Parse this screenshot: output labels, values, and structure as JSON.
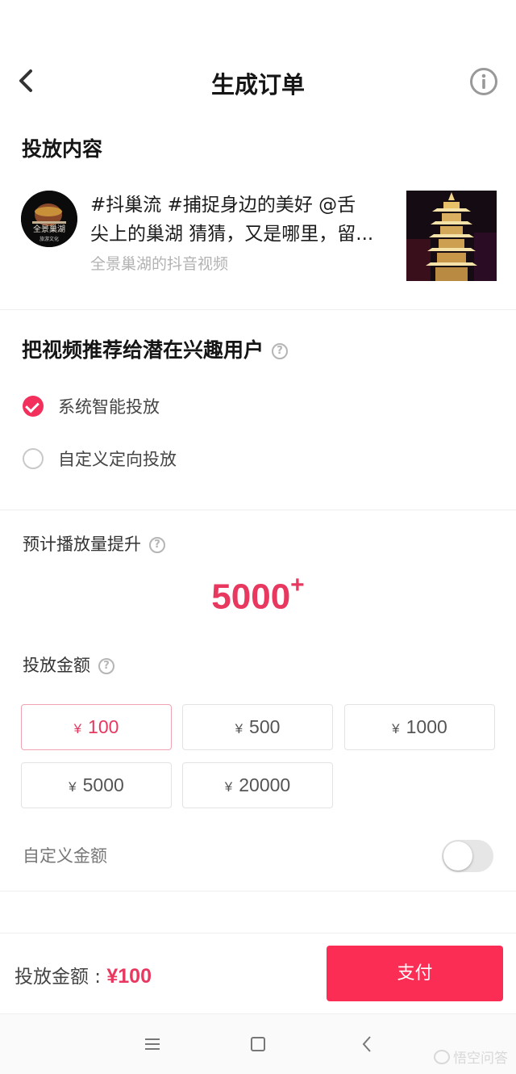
{
  "header": {
    "title": "生成订单"
  },
  "content_section": {
    "title": "投放内容",
    "avatar_text": "全景巢湖",
    "avatar_subtext": "旅游文化",
    "text_line1": "#抖巢流 #捕捉身边的美好 @舌",
    "text_line2": "尖上的巢湖 猜猜，又是哪里，留...",
    "subtitle": "全景巢湖的抖音视频"
  },
  "recommend_section": {
    "title": "把视频推荐给潜在兴趣用户",
    "options": [
      {
        "label": "系统智能投放",
        "selected": true
      },
      {
        "label": "自定义定向投放",
        "selected": false
      }
    ]
  },
  "estimate_section": {
    "label": "预计播放量提升",
    "value": "5000",
    "suffix": "+"
  },
  "amount_section": {
    "label": "投放金额",
    "currency": "¥",
    "options": [
      "100",
      "500",
      "1000",
      "5000",
      "20000"
    ],
    "selected": "100",
    "custom_label": "自定义金额",
    "custom_enabled": false
  },
  "bottom_bar": {
    "total_label": "投放金额 : ",
    "total_value": "¥100",
    "pay_label": "支付"
  },
  "navbar": {
    "watermark": "悟空问答"
  },
  "colors": {
    "accent": "#fb2d54",
    "accent_text": "#e8385f"
  }
}
